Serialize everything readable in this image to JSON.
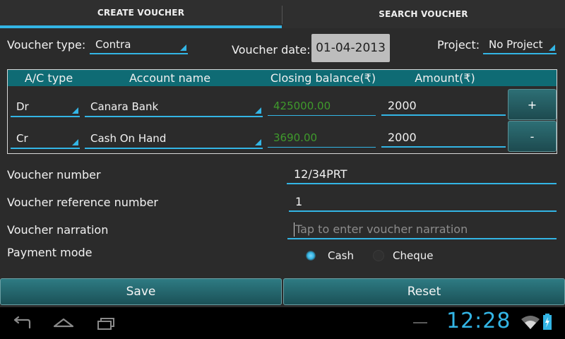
{
  "tabs": [
    {
      "label": "CREATE VOUCHER"
    },
    {
      "label": "SEARCH VOUCHER"
    }
  ],
  "voucher_type": {
    "label": "Voucher type:",
    "value": "Contra"
  },
  "voucher_date": {
    "label": "Voucher date:",
    "value": "01-04-2013"
  },
  "project": {
    "label": "Project:",
    "value": "No Project"
  },
  "table": {
    "headers": [
      "A/C type",
      "Account name",
      "Closing balance(₹)",
      "Amount(₹)"
    ],
    "rows": [
      {
        "ac_type": "Dr",
        "account_name": "Canara Bank",
        "closing_balance": "425000.00",
        "amount": "2000"
      },
      {
        "ac_type": "Cr",
        "account_name": "Cash On Hand",
        "closing_balance": "3690.00",
        "amount": "2000"
      }
    ],
    "add_label": "+",
    "remove_label": "-"
  },
  "voucher_number": {
    "label": "Voucher number",
    "value": "12/34PRT"
  },
  "voucher_reference": {
    "label": "Voucher reference number",
    "value": "1"
  },
  "voucher_narration": {
    "label": "Voucher narration",
    "placeholder": "Tap to enter voucher narration"
  },
  "payment_mode": {
    "label": "Payment mode",
    "options": [
      "Cash",
      "Cheque"
    ],
    "selected": "Cash"
  },
  "buttons": {
    "save": "Save",
    "reset": "Reset"
  },
  "status_bar": {
    "time": "12:28"
  },
  "colors": {
    "accent": "#33b5e5",
    "header": "#0f6b74",
    "balance_text": "#3f9a2c"
  }
}
